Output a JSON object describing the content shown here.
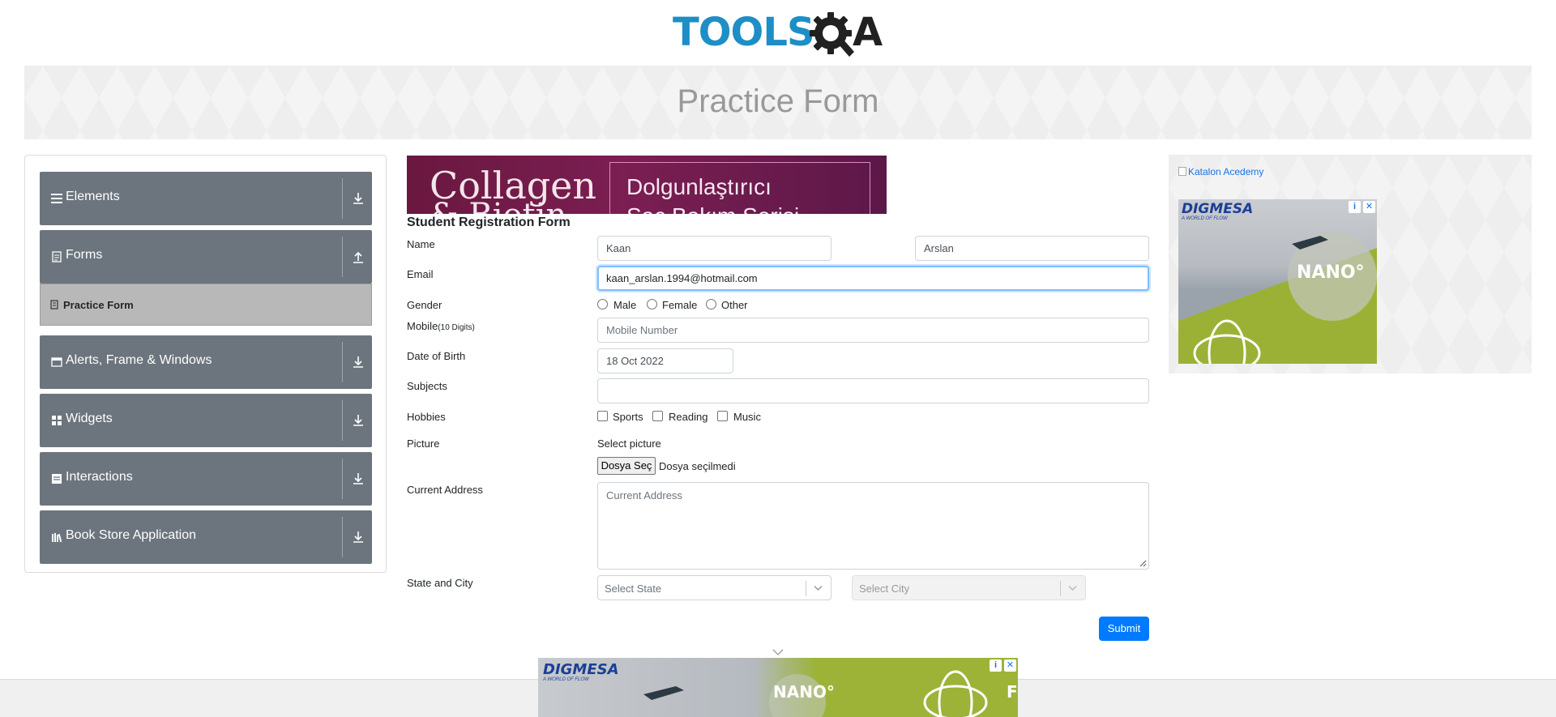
{
  "header": {
    "logo_text_tools": "TOOLS",
    "logo_text_a": "A"
  },
  "banner": {
    "title": "Practice Form"
  },
  "sidebar": {
    "groups": [
      {
        "label": "Elements",
        "icon": "hamburger-icon",
        "state": "collapsed"
      },
      {
        "label": "Forms",
        "icon": "document-icon",
        "state": "expanded"
      },
      {
        "label": "Alerts, Frame & Windows",
        "icon": "window-icon",
        "state": "collapsed"
      },
      {
        "label": "Widgets",
        "icon": "grid-icon",
        "state": "collapsed"
      },
      {
        "label": "Interactions",
        "icon": "interactions-icon",
        "state": "collapsed"
      },
      {
        "label": "Book Store Application",
        "icon": "books-icon",
        "state": "collapsed"
      }
    ],
    "active_item": {
      "label": "Practice Form",
      "icon": "form-icon"
    }
  },
  "ad_top": {
    "text_left": "Collagen",
    "text_left2": "& Biotin",
    "text_right1": "Dolgunlaştırıcı",
    "text_right2": "Saç Bakım Serisi",
    "accent": "#7b1e52"
  },
  "form": {
    "title": "Student Registration Form",
    "labels": {
      "name": "Name",
      "email": "Email",
      "gender": "Gender",
      "mobile": "Mobile",
      "mobile_hint": "(10 Digits)",
      "dob": "Date of Birth",
      "subjects": "Subjects",
      "hobbies": "Hobbies",
      "picture": "Picture",
      "address": "Current Address",
      "state_city": "State and City"
    },
    "first_name": "Kaan",
    "last_name": "Arslan",
    "email": "kaan_arslan.1994@hotmail.com",
    "gender_options": [
      "Male",
      "Female",
      "Other"
    ],
    "mobile_placeholder": "Mobile Number",
    "dob": "18 Oct 2022",
    "subjects_value": "",
    "hobbies_options": [
      "Sports",
      "Reading",
      "Music"
    ],
    "picture_label": "Select picture",
    "file_button": "Dosya Seç",
    "file_status": "Dosya seçilmedi",
    "address_placeholder": "Current Address",
    "state_placeholder": "Select State",
    "city_placeholder": "Select City",
    "submit": "Submit"
  },
  "ad_right": {
    "link_text": "Katalon Acedemy",
    "brand": "DIGMESA",
    "tagline": "A WORLD OF FLOW",
    "product": "NANO°",
    "info_icon": "info-icon",
    "close_icon": "close-icon"
  },
  "ad_bottom": {
    "brand": "DIGMESA",
    "tagline": "A WORLD OF FLOW",
    "product": "NANO°",
    "trailing_text": "FI"
  },
  "colors": {
    "primary": "#007bff",
    "sidebar_bg": "#6c757d",
    "active_item_bg": "#b8b8b8",
    "logo_blue": "#1d8ec6",
    "focus_border": "#80bdff"
  }
}
